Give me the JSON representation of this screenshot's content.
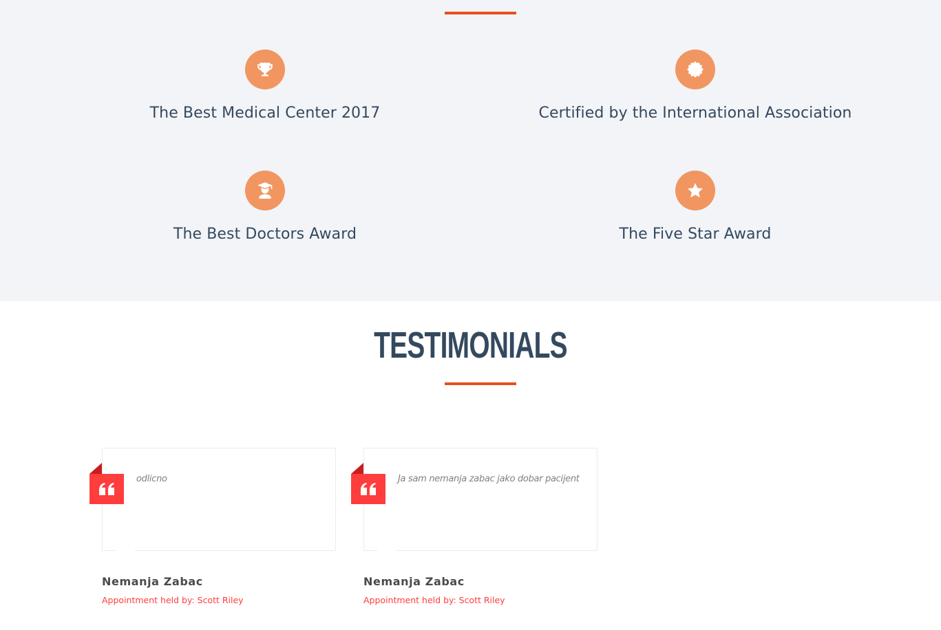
{
  "colors": {
    "accent_line": "#e8501e",
    "award_icon_bg": "#f19660",
    "heading_text": "#34495e",
    "quote_badge": "#ff3d3d",
    "meta_text": "#ff3d3d",
    "section_bg": "#f3f4f8"
  },
  "awards": [
    {
      "icon": "trophy-icon",
      "title": "The Best Medical Center 2017"
    },
    {
      "icon": "certificate-badge-icon",
      "title": "Certified by the International Association"
    },
    {
      "icon": "graduate-doctor-icon",
      "title": "The Best Doctors Award"
    },
    {
      "icon": "star-icon",
      "title": "The Five Star Award"
    }
  ],
  "testimonials": {
    "heading": "TESTIMONIALS",
    "items": [
      {
        "quote_icon": "quote-icon",
        "text": "odlicno",
        "author": "Nemanja Zabac",
        "meta": "Appointment held by: Scott Riley"
      },
      {
        "quote_icon": "quote-icon",
        "text": "Ja sam nemanja zabac jako dobar pacijent",
        "author": "Nemanja Zabac",
        "meta": "Appointment held by: Scott Riley"
      }
    ]
  }
}
